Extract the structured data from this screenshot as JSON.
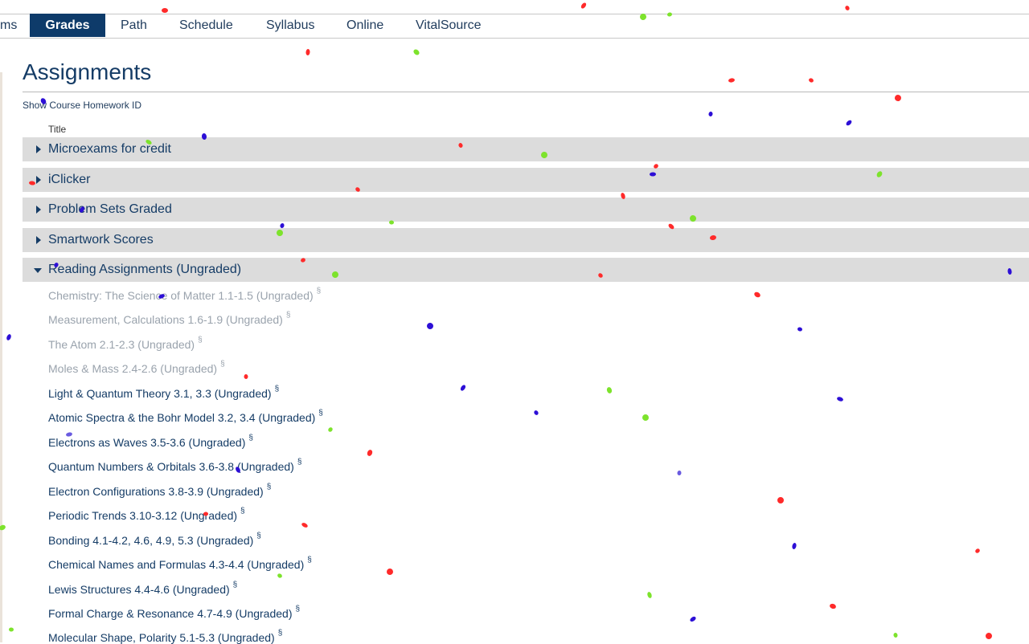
{
  "nav": {
    "tabs": [
      {
        "label": "ms"
      },
      {
        "label": "Grades"
      },
      {
        "label": "Path"
      },
      {
        "label": "Schedule"
      },
      {
        "label": "Syllabus"
      },
      {
        "label": "Online"
      },
      {
        "label": "VitalSource"
      }
    ],
    "active_tab": "Grades"
  },
  "page": {
    "title": "Assignments",
    "show_homework_id": "Show Course Homework ID",
    "column_title": "Title"
  },
  "groups": [
    {
      "label": "Microexams for credit",
      "expanded": false
    },
    {
      "label": "iClicker",
      "expanded": false
    },
    {
      "label": "Problem Sets Graded",
      "expanded": false
    },
    {
      "label": "Smartwork Scores",
      "expanded": false
    },
    {
      "label": "Reading Assignments (Ungraded)",
      "expanded": true
    }
  ],
  "readings": [
    {
      "title": "Chemistry: The Science of Matter 1.1-1.5 (Ungraded)",
      "completed": true
    },
    {
      "title": "Measurement, Calculations 1.6-1.9 (Ungraded)",
      "completed": true
    },
    {
      "title": "The Atom 2.1-2.3 (Ungraded)",
      "completed": true
    },
    {
      "title": "Moles & Mass 2.4-2.6 (Ungraded)",
      "completed": true
    },
    {
      "title": "Light & Quantum Theory 3.1, 3.3 (Ungraded)",
      "completed": false
    },
    {
      "title": "Atomic Spectra & the Bohr Model 3.2, 3.4 (Ungraded)",
      "completed": false
    },
    {
      "title": "Electrons as Waves 3.5-3.6 (Ungraded)",
      "completed": false
    },
    {
      "title": "Quantum Numbers & Orbitals 3.6-3.8 (Ungraded)",
      "completed": false
    },
    {
      "title": "Electron Configurations 3.8-3.9 (Ungraded)",
      "completed": false
    },
    {
      "title": "Periodic Trends 3.10-3.12 (Ungraded)",
      "completed": false
    },
    {
      "title": "Bonding 4.1-4.2, 4.6, 4.9, 5.3 (Ungraded)",
      "completed": false
    },
    {
      "title": "Chemical Names and Formulas 4.3-4.4 (Ungraded)",
      "completed": false
    },
    {
      "title": "Lewis Structures 4.4-4.6 (Ungraded)",
      "completed": false
    },
    {
      "title": "Formal Charge & Resonance 4.7-4.9 (Ungraded)",
      "completed": false
    },
    {
      "title": "Molecular Shape, Polarity 5.1-5.3 (Ungraded)",
      "completed": false
    }
  ],
  "section_mark": "§",
  "colors": {
    "nav_active": "#0e3b6a",
    "group_bg": "#dcdcdc",
    "completed_text": "#9aa3ad",
    "confetti": [
      "#ff2a2a",
      "#2d0fd6",
      "#7de32c",
      "#6a5be0"
    ]
  }
}
